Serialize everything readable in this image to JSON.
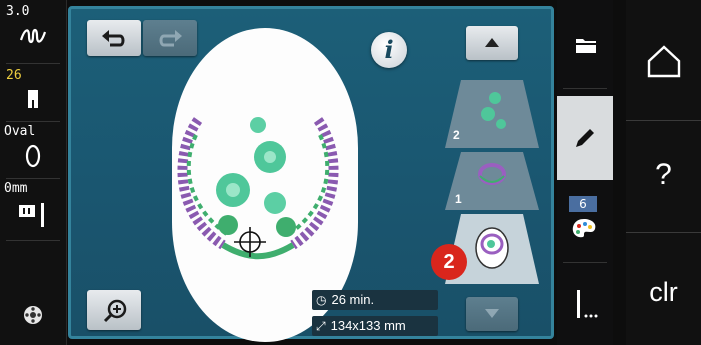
{
  "status_bar": {
    "stitch_width": "3.0",
    "stitch_width_icon": "zigzag-icon",
    "presser_foot_number": "26",
    "presser_foot_icon": "presser-foot-icon",
    "hoop_label": "Oval",
    "hoop_icon": "oval-hoop-icon",
    "needle_position": "0mm",
    "needle_icon": "needle-plate-icon",
    "bobbin_icon": "bobbin-icon"
  },
  "toolbar": {
    "undo_icon": "undo-icon",
    "redo_icon": "redo-icon",
    "info_label": "i",
    "zoom_icon": "zoom-in-icon"
  },
  "layers": {
    "scroll_up_icon": "arrow-up-icon",
    "scroll_down_icon": "arrow-down-icon",
    "items": [
      {
        "number": "2"
      },
      {
        "number": "1"
      },
      {
        "number": ""
      }
    ]
  },
  "info_chips": {
    "time": "26 min.",
    "time_icon": "clock-icon",
    "size": "134x133 mm",
    "size_icon": "resize-icon"
  },
  "right_tabs": {
    "selection_icon": "folder-icon",
    "edit_icon": "pencil-icon",
    "color_count": "6",
    "color_icon": "palette-icon",
    "stitch_icon": "stitch-out-icon"
  },
  "system_buttons": {
    "home_icon": "home-icon",
    "help_label": "?",
    "clear_label": "clr"
  },
  "callout": "2",
  "colors": {
    "screen": "#1a5670",
    "accent_red": "#d9261c",
    "embroidery_green": "#4fc79a",
    "embroidery_purple": "#9a5fc0"
  }
}
